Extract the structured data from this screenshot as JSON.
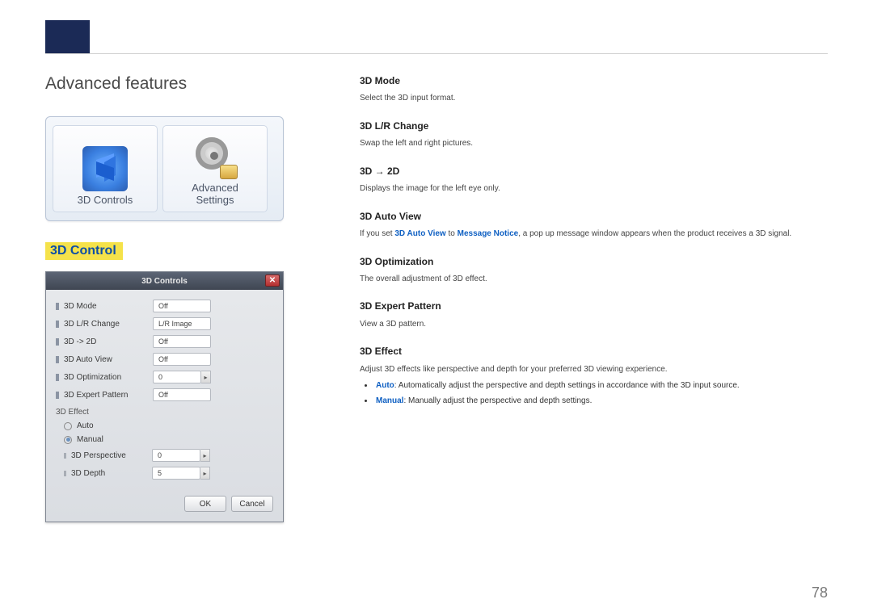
{
  "page": {
    "title": "Advanced features",
    "section": "3D Control",
    "page_number": "78"
  },
  "tiles": {
    "controls_label": "3D Controls",
    "advanced_label": "Advanced\nSettings"
  },
  "dialog": {
    "title": "3D Controls",
    "rows": {
      "mode_label": "3D Mode",
      "mode_value": "Off",
      "lr_label": "3D L/R Change",
      "lr_value": "L/R Image",
      "to2d_label": "3D -> 2D",
      "to2d_value": "Off",
      "autoview_label": "3D Auto View",
      "autoview_value": "Off",
      "opt_label": "3D Optimization",
      "opt_value": "0",
      "pattern_label": "3D Expert Pattern",
      "pattern_value": "Off"
    },
    "effect_heading": "3D Effect",
    "radio_auto": "Auto",
    "radio_manual": "Manual",
    "perspective_label": "3D Perspective",
    "perspective_value": "0",
    "depth_label": "3D Depth",
    "depth_value": "5",
    "ok": "OK",
    "cancel": "Cancel"
  },
  "right": {
    "mode_h": "3D Mode",
    "mode_d": "Select the 3D input format.",
    "lr_h": "3D L/R Change",
    "lr_d": "Swap the left and right pictures.",
    "to2d_h": "3D → 2D",
    "to2d_d": "Displays the image for the left eye only.",
    "autoview_h": "3D Auto View",
    "autoview_d_pre": "If you set ",
    "autoview_d_kw1": "3D Auto View",
    "autoview_d_mid": " to ",
    "autoview_d_kw2": "Message Notice",
    "autoview_d_post": ", a pop up message window appears when the product receives a 3D signal.",
    "opt_h": "3D Optimization",
    "opt_d": "The overall adjustment of 3D effect.",
    "pattern_h": "3D Expert Pattern",
    "pattern_d": "View a 3D pattern.",
    "effect_h": "3D Effect",
    "effect_d": "Adjust 3D effects like perspective and depth for your preferred 3D viewing experience.",
    "effect_auto_kw": "Auto",
    "effect_auto_rest": ": Automatically adjust the perspective and depth settings in accordance with the 3D input source.",
    "effect_manual_kw": "Manual",
    "effect_manual_rest": ": Manually adjust the perspective and depth settings."
  }
}
